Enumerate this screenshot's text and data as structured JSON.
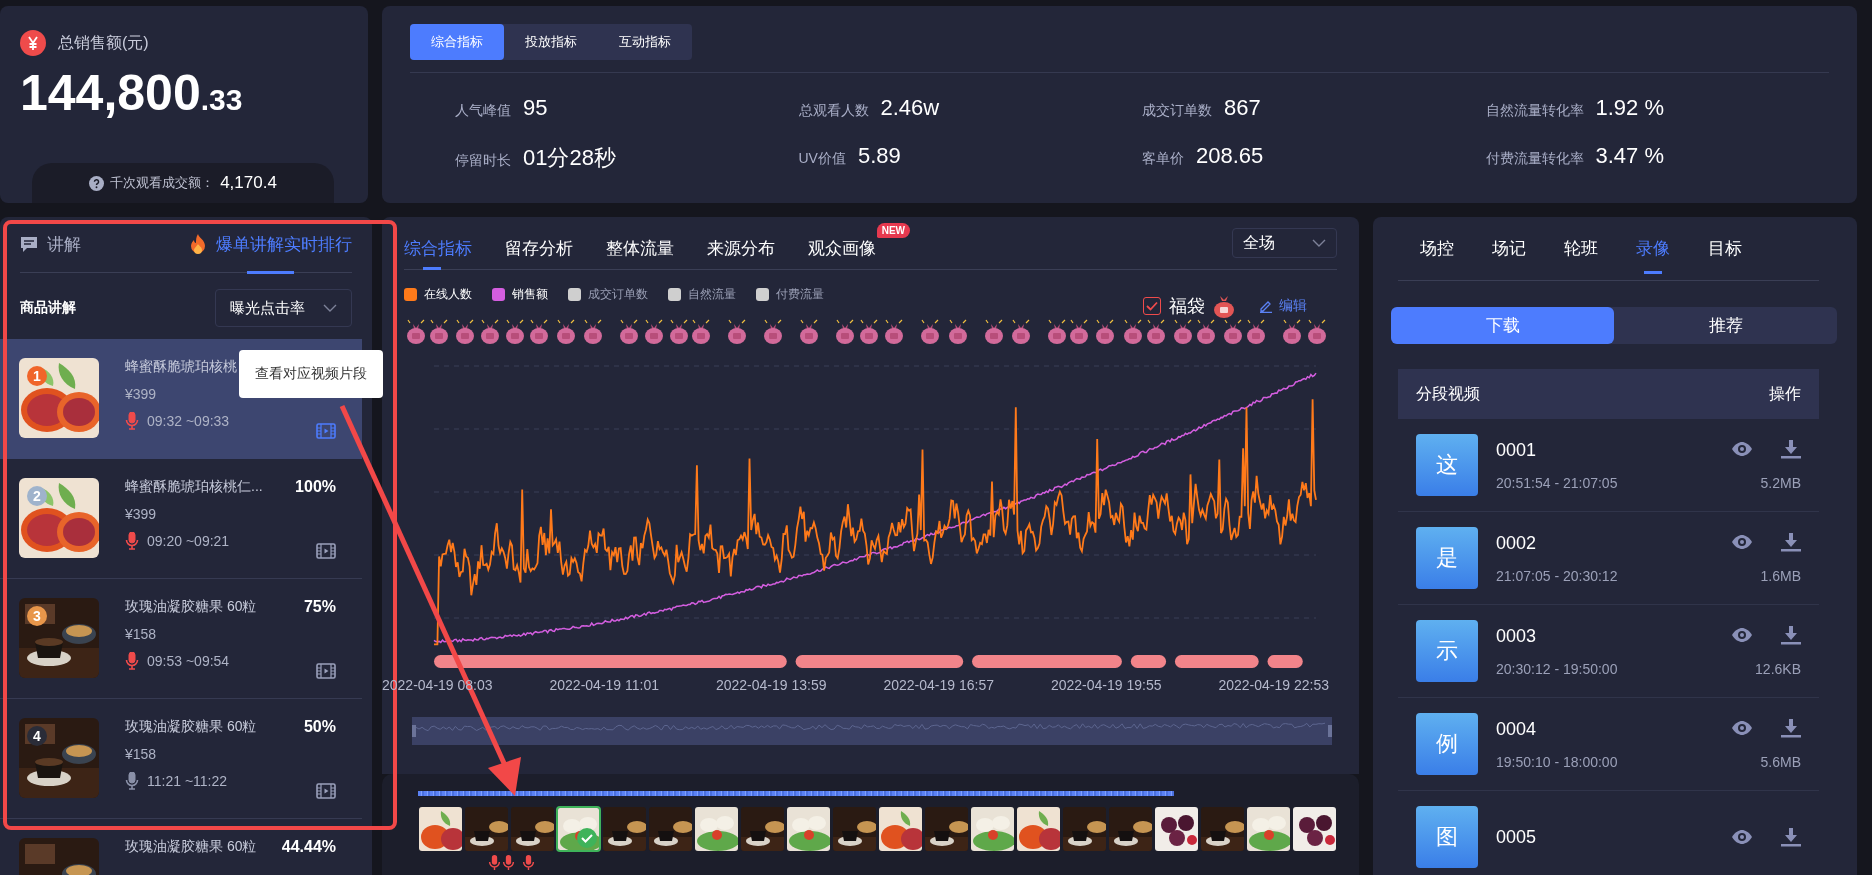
{
  "sales": {
    "title": "总销售额(元)",
    "amount": "144,800",
    "decimals": ".33",
    "per_thousand_label": "千次观看成交额：",
    "per_thousand_value": "4,170.4"
  },
  "metric_tabs": [
    {
      "label": "综合指标",
      "selected": true
    },
    {
      "label": "投放指标",
      "selected": false
    },
    {
      "label": "互动指标",
      "selected": false
    }
  ],
  "metrics": [
    {
      "label": "人气峰值",
      "value": "95"
    },
    {
      "label": "总观看人数",
      "value": "2.46w"
    },
    {
      "label": "成交订单数",
      "value": "867"
    },
    {
      "label": "自然流量转化率",
      "value": "1.92 %"
    },
    {
      "label": "停留时长",
      "value": "01分28秒"
    },
    {
      "label": "UV价值",
      "value": "5.89"
    },
    {
      "label": "客单价",
      "value": "208.65"
    },
    {
      "label": "付费流量转化率",
      "value": "3.47 %"
    }
  ],
  "explain_panel": {
    "tabs": [
      {
        "label": "讲解",
        "kind": "chat",
        "selected": false
      },
      {
        "label": "爆单讲解实时排行",
        "kind": "hot",
        "selected": true
      }
    ],
    "filter_label": "商品讲解",
    "sort": "曝光点击率",
    "products": [
      {
        "rank": "1",
        "color": "#f0652a",
        "name": "蜂蜜酥脆琥珀核桃",
        "price": "¥399",
        "time": "09:32 ~09:33",
        "mic_active": true,
        "selected": true
      },
      {
        "rank": "2",
        "color": "#9fb3cc",
        "name": "蜂蜜酥脆琥珀核桃仁...",
        "percent": "100%",
        "price": "¥399",
        "time": "09:20 ~09:21",
        "mic_active": true,
        "selected": false
      },
      {
        "rank": "3",
        "color": "#e8964a",
        "name": "玫瑰油凝胶糖果 60粒",
        "percent": "75%",
        "price": "¥158",
        "time": "09:53 ~09:54",
        "mic_active": true,
        "selected": false
      },
      {
        "rank": "4",
        "color": "#2a2c38",
        "name": "玫瑰油凝胶糖果 60粒",
        "percent": "50%",
        "price": "¥158",
        "time": "11:21 ~11:22",
        "mic_active": false,
        "selected": false
      },
      {
        "name": "玫瑰油凝胶糖果 60粒",
        "percent": "44.44%",
        "selected": false
      }
    ]
  },
  "tooltip": "查看对应视频片段",
  "chart_panel": {
    "tabs": [
      {
        "label": "综合指标",
        "selected": true
      },
      {
        "label": "留存分析",
        "selected": false
      },
      {
        "label": "整体流量",
        "selected": false
      },
      {
        "label": "来源分布",
        "selected": false
      },
      {
        "label": "观众画像",
        "badge": "NEW",
        "selected": false
      }
    ],
    "range": "全场",
    "legend": [
      {
        "label": "在线人数",
        "color": "#ff7a1a",
        "on": true
      },
      {
        "label": "销售额",
        "color": "#d45ee0",
        "on": true
      },
      {
        "label": "成交订单数",
        "color": "#cfcfcf",
        "on": false
      },
      {
        "label": "自然流量",
        "color": "#cfcfcf",
        "on": false
      },
      {
        "label": "付费流量",
        "color": "#cfcfcf",
        "on": false
      }
    ],
    "lucky_bag": {
      "label": "福袋",
      "checked": true
    },
    "edit": "编辑",
    "x_labels": [
      "2022-04-19 08:03",
      "2022-04-19 11:01",
      "2022-04-19 13:59",
      "2022-04-19 16:57",
      "2022-04-19 19:55",
      "2022-04-19 22:53"
    ]
  },
  "timeline": {
    "clips": [
      {
        "selected": false
      },
      {
        "selected": false
      },
      {
        "selected": false
      },
      {
        "selected": true
      },
      {
        "selected": false
      },
      {
        "selected": false
      },
      {
        "selected": false
      },
      {
        "selected": false
      },
      {
        "selected": false
      },
      {
        "selected": false
      },
      {
        "selected": false
      },
      {
        "selected": false
      },
      {
        "selected": false
      },
      {
        "selected": false
      },
      {
        "selected": false
      },
      {
        "selected": false
      },
      {
        "selected": false
      },
      {
        "selected": false
      },
      {
        "selected": false
      },
      {
        "selected": false
      }
    ]
  },
  "right_panel": {
    "tabs": [
      {
        "label": "场控",
        "selected": false
      },
      {
        "label": "场记",
        "selected": false
      },
      {
        "label": "轮班",
        "selected": false
      },
      {
        "label": "录像",
        "selected": true
      },
      {
        "label": "目标",
        "selected": false
      }
    ],
    "segments": [
      {
        "label": "下载",
        "selected": true
      },
      {
        "label": "推荐",
        "selected": false
      }
    ],
    "table": {
      "columns": [
        "分段视频",
        "操作"
      ],
      "rows": [
        {
          "avatar": "这",
          "name": "0001",
          "time": "20:51:54 - 21:07:05",
          "size": "5.2MB"
        },
        {
          "avatar": "是",
          "name": "0002",
          "time": "21:07:05 - 20:30:12",
          "size": "1.6MB"
        },
        {
          "avatar": "示",
          "name": "0003",
          "time": "20:30:12 - 19:50:00",
          "size": "12.6KB"
        },
        {
          "avatar": "例",
          "name": "0004",
          "time": "19:50:10 - 18:00:00",
          "size": "5.6MB"
        },
        {
          "avatar": "图",
          "name": "0005"
        }
      ]
    }
  }
}
